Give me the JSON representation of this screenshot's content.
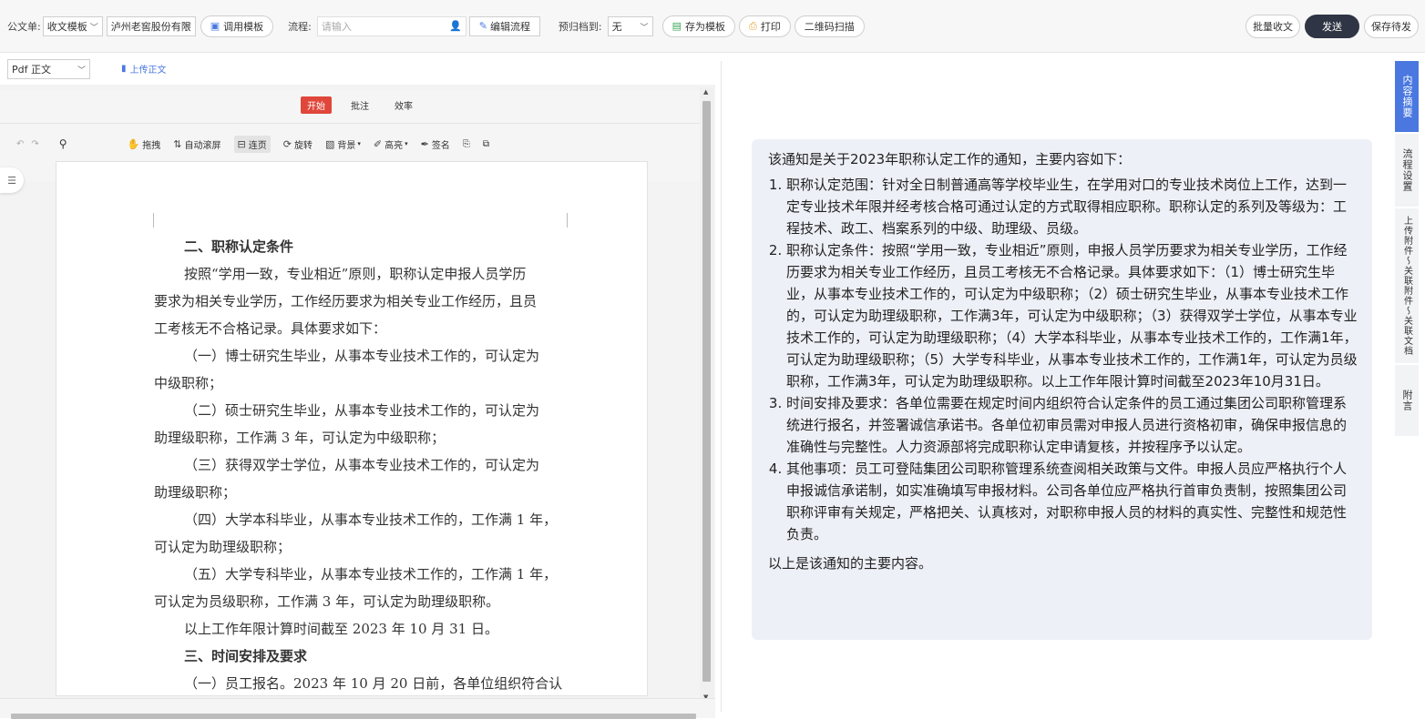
{
  "toolbar": {
    "doc_type_label": "公文单:",
    "doc_type_value": "收文模板",
    "company_value": "泸州老窖股份有限",
    "use_template": "调用模板",
    "flow_label": "流程:",
    "flow_placeholder": "请输入",
    "edit_flow": "编辑流程",
    "archive_label": "预归档到:",
    "archive_value": "无",
    "save_template": "存为模板",
    "print": "打印",
    "qr_scan": "二维码扫描",
    "batch_receive": "批量收文",
    "send": "发送",
    "save_pending": "保存待发"
  },
  "viewer": {
    "file_select": "Pdf 正文",
    "upload": "上传正文",
    "tabs": [
      "开始",
      "批注",
      "效率"
    ],
    "tools": [
      "拖拽",
      "自动滚屏",
      "连页",
      "旋转",
      "背景",
      "高亮",
      "签名"
    ]
  },
  "document": {
    "lines": [
      {
        "text": "二、职称认定条件",
        "kind": "heading"
      },
      {
        "text": "按照“学用一致，专业相近”原则，职称认定申报人员学历",
        "kind": "indent"
      },
      {
        "text": "要求为相关专业学历，工作经历要求为相关专业工作经历，且员",
        "kind": "body"
      },
      {
        "text": "工考核无不合格记录。具体要求如下：",
        "kind": "body"
      },
      {
        "text": "（一）博士研究生毕业，从事本专业技术工作的，可认定为",
        "kind": "indent"
      },
      {
        "text": "中级职称；",
        "kind": "body"
      },
      {
        "text": "（二）硕士研究生毕业，从事本专业技术工作的，可认定为",
        "kind": "indent"
      },
      {
        "text": "助理级职称，工作满 3 年，可认定为中级职称；",
        "kind": "body"
      },
      {
        "text": "（三）获得双学士学位，从事本专业技术工作的，可认定为",
        "kind": "indent"
      },
      {
        "text": "助理级职称；",
        "kind": "body"
      },
      {
        "text": "（四）大学本科毕业，从事本专业技术工作的，工作满 1 年，",
        "kind": "indent"
      },
      {
        "text": "可认定为助理级职称；",
        "kind": "body"
      },
      {
        "text": "（五）大学专科毕业，从事本专业技术工作的，工作满 1 年，",
        "kind": "indent"
      },
      {
        "text": "可认定为员级职称，工作满 3 年，可认定为助理级职称。",
        "kind": "body"
      },
      {
        "text": "以上工作年限计算时间截至 2023 年 10 月 31 日。",
        "kind": "indent"
      },
      {
        "text": "三、时间安排及要求",
        "kind": "heading"
      },
      {
        "text": "（一）员工报名。2023 年 10 月 20 日前，各单位组织符合认",
        "kind": "indent"
      }
    ]
  },
  "summary": {
    "intro": "该通知是关于2023年职称认定工作的通知，主要内容如下：",
    "items": [
      "职称认定范围：针对全日制普通高等学校毕业生，在学用对口的专业技术岗位上工作，达到一定专业技术年限并经考核合格可通过认定的方式取得相应职称。职称认定的系列及等级为：工程技术、政工、档案系列的中级、助理级、员级。",
      "职称认定条件：按照“学用一致，专业相近”原则，申报人员学历要求为相关专业学历，工作经历要求为相关专业工作经历，且员工考核无不合格记录。具体要求如下：（1）博士研究生毕业，从事本专业技术工作的，可认定为中级职称；（2）硕士研究生毕业，从事本专业技术工作的，可认定为助理级职称，工作满3年，可认定为中级职称；（3）获得双学士学位，从事本专业技术工作的，可认定为助理级职称；（4）大学本科毕业，从事本专业技术工作的，工作满1年，可认定为助理级职称；（5）大学专科毕业，从事本专业技术工作的，工作满1年，可认定为员级职称，工作满3年，可认定为助理级职称。以上工作年限计算时间截至2023年10月31日。",
      "时间安排及要求：各单位需要在规定时间内组织符合认定条件的员工通过集团公司职称管理系统进行报名，并签署诚信承诺书。各单位初审员需对申报人员进行资格初审，确保申报信息的准确性与完整性。人力资源部将完成职称认定申请复核，并按程序予以认定。",
      "其他事项：员工可登陆集团公司职称管理系统查阅相关政策与文件。申报人员应严格执行个人申报诚信承诺制，如实准确填写申报材料。公司各单位应严格执行首审负责制，按照集团公司职称评审有关规定，严格把关、认真核对，对职称申报人员的材料的真实性、完整性和规范性负责。"
    ],
    "outro": "以上是该通知的主要内容。"
  },
  "side_tabs": [
    "内容摘要",
    "流程设置",
    "上传附件～关联附件～关联文档",
    "附言"
  ],
  "colors": {
    "accent": "#4a78e0",
    "send": "#2f3544",
    "tab_active": "#e0463a"
  }
}
